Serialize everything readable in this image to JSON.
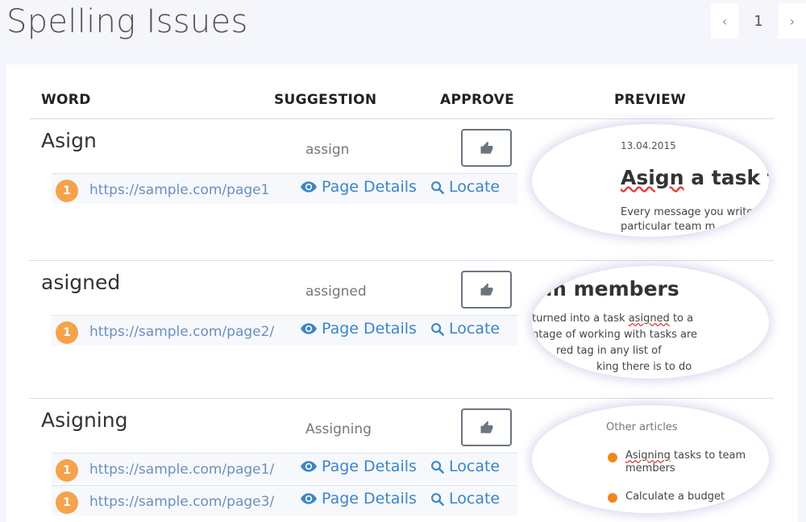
{
  "page": {
    "title": "Spelling Issues"
  },
  "pager": {
    "prev": "‹",
    "current": "1",
    "next": "›"
  },
  "columns": {
    "word": "WORD",
    "suggestion": "SUGGESTION",
    "approve": "APPROVE",
    "preview": "PREVIEW"
  },
  "issues": [
    {
      "word": "Asign",
      "suggestion": "assign",
      "pages": [
        {
          "count": "1",
          "url": "https://sample.com/page1",
          "details": "Page Details",
          "locate": "Locate"
        }
      ],
      "preview": {
        "date": "13.04.2015",
        "title_word": "Asign",
        "title_rest": " a task to",
        "line1": "Every message you write",
        "line2": "particular team m..."
      }
    },
    {
      "word": "asigned",
      "suggestion": "assigned",
      "pages": [
        {
          "count": "1",
          "url": "https://sample.com/page2/",
          "details": "Page Details",
          "locate": "Locate"
        }
      ],
      "preview": {
        "title": "am members",
        "line1_pre": "turned into a task ",
        "line1_word": "asigned",
        "line1_post": " to a",
        "line2": "ntage of working with tasks are",
        "line3": "red tag in any list of",
        "line4": "king there is to do"
      }
    },
    {
      "word": "Asigning",
      "suggestion": "Assigning",
      "pages": [
        {
          "count": "1",
          "url": "https://sample.com/page1/",
          "details": "Page Details",
          "locate": "Locate"
        },
        {
          "count": "1",
          "url": "https://sample.com/page3/",
          "details": "Page Details",
          "locate": "Locate"
        }
      ],
      "preview": {
        "heading": "Other articles",
        "item1_word": "Asigning",
        "item1_rest": " tasks to team",
        "item1_line2": "members",
        "item2": "Calculate a budget"
      }
    }
  ],
  "colors": {
    "accent": "#3b86c6",
    "badge": "#f5a34b",
    "url": "#6c8fbd"
  }
}
